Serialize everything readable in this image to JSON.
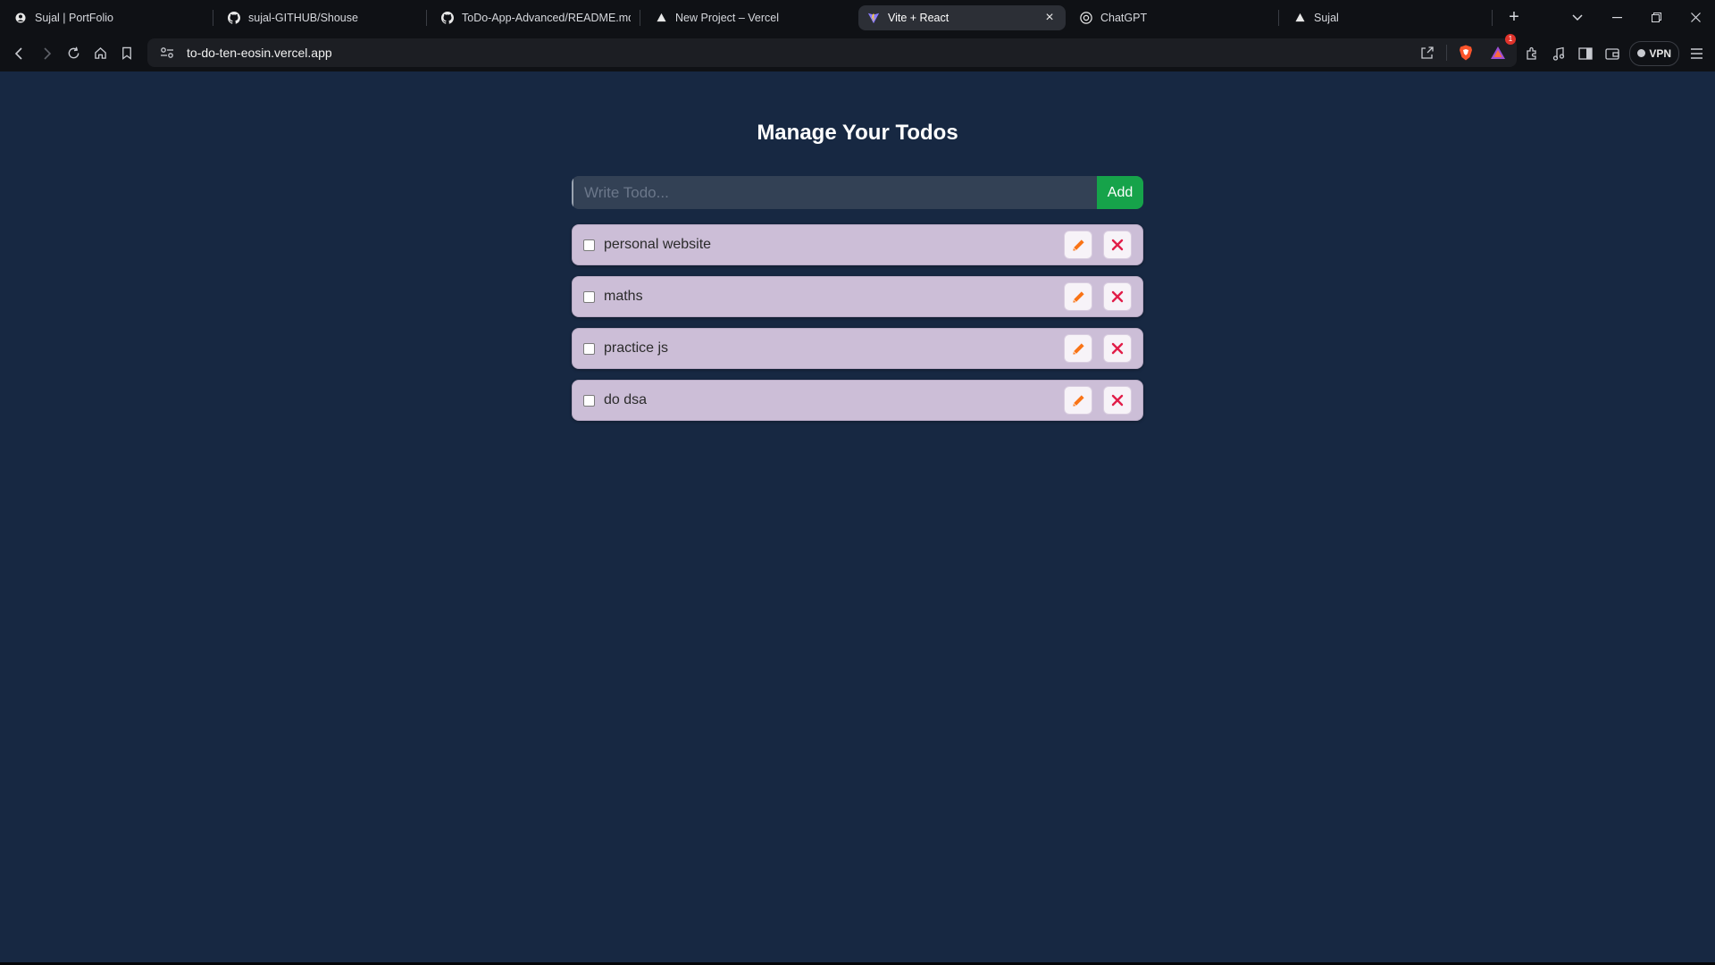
{
  "browser": {
    "tabs": [
      {
        "title": "Sujal | PortFolio",
        "icon": "sujal-icon",
        "active": false
      },
      {
        "title": "sujal-GITHUB/Shouse",
        "icon": "github-icon",
        "active": false
      },
      {
        "title": "ToDo-App-Advanced/README.md at",
        "icon": "github-icon",
        "active": false
      },
      {
        "title": "New Project – Vercel",
        "icon": "vercel-icon",
        "active": false
      },
      {
        "title": "Vite + React",
        "icon": "vite-icon",
        "active": true
      },
      {
        "title": "ChatGPT",
        "icon": "chatgpt-icon",
        "active": false
      },
      {
        "title": "Sujal",
        "icon": "vercel-icon",
        "active": false
      }
    ],
    "url": "to-do-ten-eosin.vercel.app",
    "vpn_label": "VPN",
    "notification_count": "1"
  },
  "app": {
    "title": "Manage Your Todos",
    "input_placeholder": "Write Todo...",
    "input_value": "",
    "add_label": "Add",
    "colors": {
      "page_bg": "#172842",
      "item_bg": "#ccbed7",
      "add_bg": "#16a34a",
      "input_bg": "#334155",
      "delete_color": "#e11d48",
      "edit_color": "#f97316"
    },
    "todos": [
      {
        "text": "personal website",
        "completed": false
      },
      {
        "text": "maths",
        "completed": false
      },
      {
        "text": "practice js",
        "completed": false
      },
      {
        "text": "do dsa",
        "completed": false
      }
    ]
  }
}
